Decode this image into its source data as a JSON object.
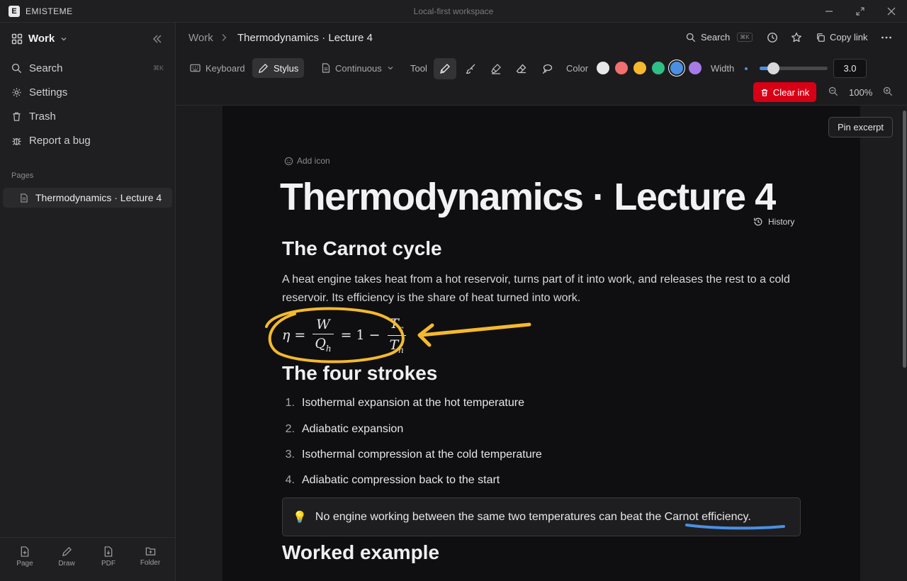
{
  "app": {
    "name": "EMISTEME",
    "logo_letter": "E",
    "window_title": "Local-first workspace"
  },
  "sidebar": {
    "workspace": "Work",
    "nav": [
      {
        "label": "Search",
        "shortcut": "⌘K",
        "icon": "search-icon"
      },
      {
        "label": "Settings",
        "icon": "gear-icon"
      },
      {
        "label": "Trash",
        "icon": "trash-icon"
      },
      {
        "label": "Report a bug",
        "icon": "bug-icon"
      }
    ],
    "pages_label": "Pages",
    "pages": [
      {
        "label": "Thermodynamics · Lecture 4",
        "icon": "page-icon"
      }
    ],
    "bottom": [
      {
        "label": "Page",
        "icon": "new-page-icon"
      },
      {
        "label": "Draw",
        "icon": "pen-icon"
      },
      {
        "label": "PDF",
        "icon": "pdf-icon"
      },
      {
        "label": "Folder",
        "icon": "folder-icon"
      }
    ]
  },
  "header": {
    "breadcrumb_root": "Work",
    "breadcrumb_sep": "›",
    "breadcrumb_page": "Thermodynamics · Lecture 4",
    "search_label": "Search",
    "search_shortcut": "⌘K",
    "copy_link_label": "Copy link"
  },
  "toolbar": {
    "keyboard_label": "Keyboard",
    "stylus_label": "Stylus",
    "layout_label": "Continuous",
    "tool_label": "Tool",
    "tools": [
      "pen-icon",
      "brush-icon",
      "highlighter-icon",
      "eraser-icon",
      "lasso-icon"
    ],
    "active_tool": "pen-icon",
    "color_label": "Color",
    "colors": [
      "#e8e8ea",
      "#f07070",
      "#f5b92d",
      "#2fbf86",
      "#4a90e2",
      "#a87ae8"
    ],
    "selected_color": "#4a90e2",
    "width_label": "Width",
    "width_value": "3.0",
    "width_fraction": 0.2,
    "clear_ink_label": "Clear ink",
    "zoom_level": "100%"
  },
  "canvas": {
    "pin_label": "Pin excerpt",
    "add_icon_label": "Add icon",
    "history_label": "History",
    "title": "Thermodynamics · Lecture 4",
    "heading1": "The Carnot cycle",
    "paragraph": "A heat engine takes heat from a hot reservoir, turns part of it into work, and releases the rest to a cold reservoir. Its efficiency is the share of heat turned into work.",
    "formula": {
      "eta": "η",
      "eq1": "=",
      "num1": "W",
      "den1_base": "Q",
      "den1_sub": "h",
      "eq2": "=",
      "one": "1",
      "minus": "−",
      "num2_base": "T",
      "num2_sub": "c",
      "den2_base": "T",
      "den2_sub": "h"
    },
    "heading2": "The four strokes",
    "strokes": [
      {
        "num": "1.",
        "text": "Isothermal expansion at the hot temperature"
      },
      {
        "num": "2.",
        "text": "Adiabatic expansion"
      },
      {
        "num": "3.",
        "text": "Isothermal compression at the cold temperature"
      },
      {
        "num": "4.",
        "text": "Adiabatic compression back to the start"
      }
    ],
    "callout": {
      "emoji": "💡",
      "text": "No engine working between the same two temperatures can beat the Carnot efficiency."
    },
    "heading3": "Worked example",
    "ink": {
      "yellow": "#f5b92d",
      "blue": "#4a90e2"
    }
  }
}
